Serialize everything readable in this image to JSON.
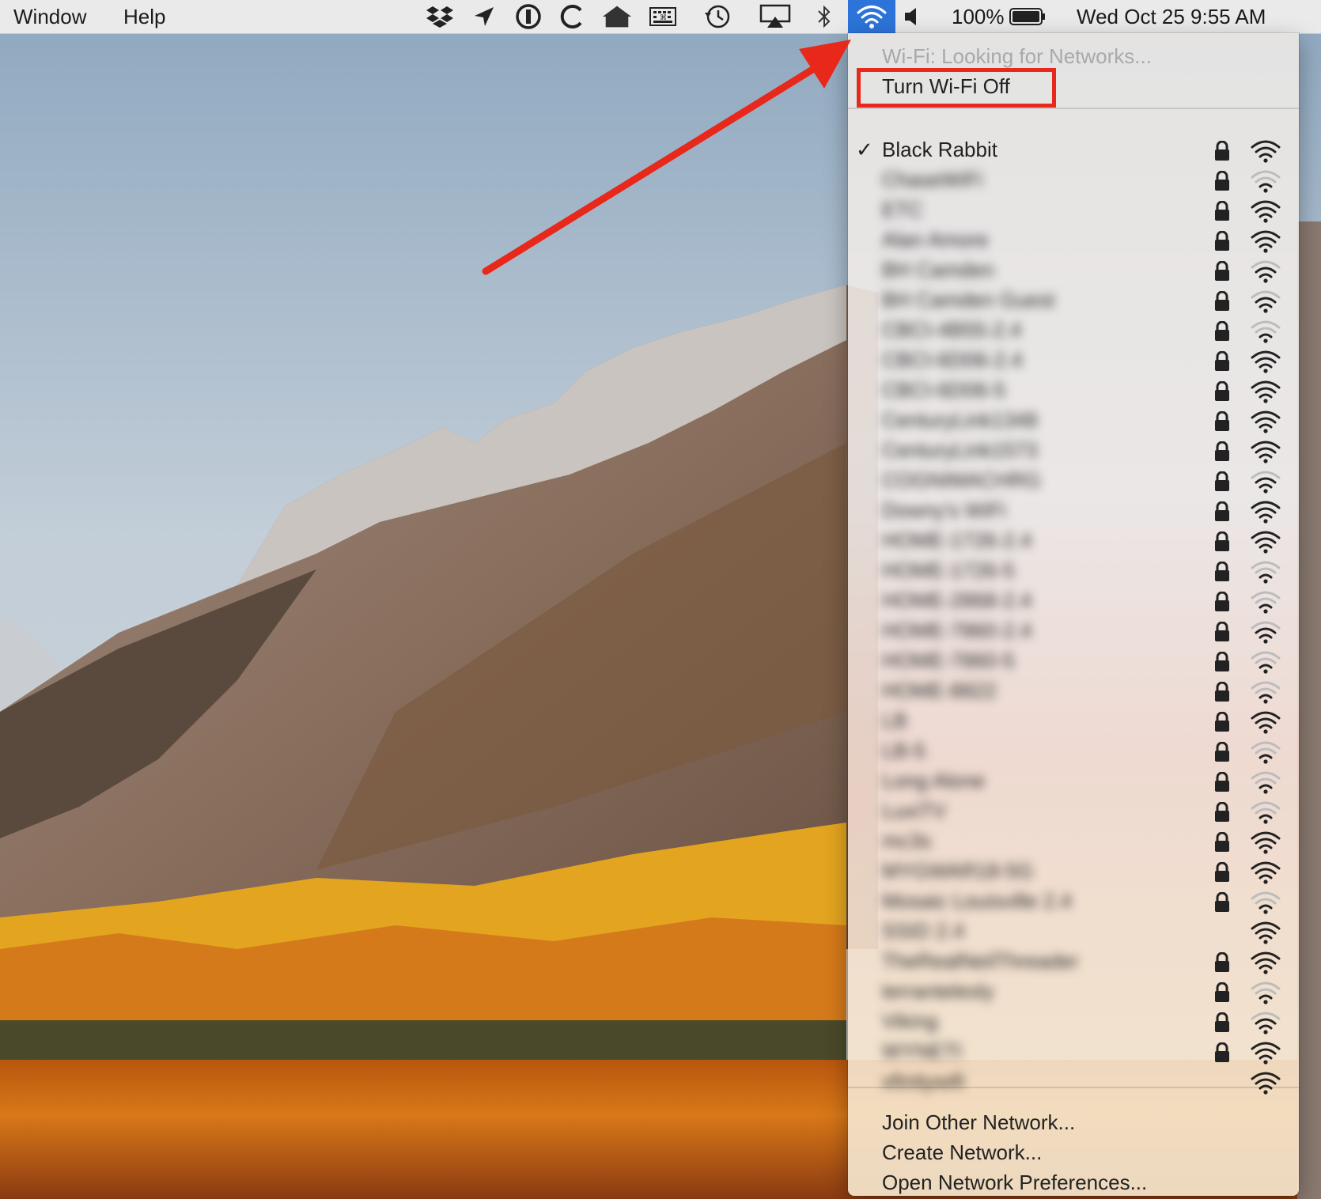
{
  "menubar": {
    "menus": [
      "Window",
      "Help"
    ],
    "status_icons": [
      "dropbox-icon",
      "location-arrow-icon",
      "1password-icon",
      "c-app-icon",
      "home-icon",
      "keyboard-viewer-icon",
      "time-machine-icon",
      "airplay-icon",
      "bluetooth-icon",
      "wifi-icon",
      "volume-icon"
    ],
    "battery_percent": "100%",
    "datetime": "Wed Oct 25  9:55 AM"
  },
  "wifi_menu": {
    "status": "Wi-Fi: Looking for Networks...",
    "toggle_label": "Turn Wi-Fi Off",
    "connected_network": "Black Rabbit",
    "networks": [
      {
        "name": "Black Rabbit",
        "secured": true,
        "signal": 3,
        "connected": true
      },
      {
        "name": "ChaseWiFi",
        "secured": true,
        "signal": 1
      },
      {
        "name": "ETC",
        "secured": true,
        "signal": 3
      },
      {
        "name": "Alan Amore",
        "secured": true,
        "signal": 3
      },
      {
        "name": "BH Camden",
        "secured": true,
        "signal": 2
      },
      {
        "name": "BH Camden Guest",
        "secured": true,
        "signal": 2
      },
      {
        "name": "CBCI-4B55-2.4",
        "secured": true,
        "signal": 1
      },
      {
        "name": "CBCI-6D06-2.4",
        "secured": true,
        "signal": 3
      },
      {
        "name": "CBCI-6D06-5",
        "secured": true,
        "signal": 3
      },
      {
        "name": "CenturyLink1348",
        "secured": true,
        "signal": 3
      },
      {
        "name": "CenturyLink1573",
        "secured": true,
        "signal": 3
      },
      {
        "name": "COGNIMACHRG",
        "secured": true,
        "signal": 2
      },
      {
        "name": "Downy's WiFi",
        "secured": true,
        "signal": 3
      },
      {
        "name": "HOME-1726-2.4",
        "secured": true,
        "signal": 3
      },
      {
        "name": "HOME-1726-5",
        "secured": true,
        "signal": 1
      },
      {
        "name": "HOME-2868-2.4",
        "secured": true,
        "signal": 1
      },
      {
        "name": "HOME-7860-2.4",
        "secured": true,
        "signal": 2
      },
      {
        "name": "HOME-7860-5",
        "secured": true,
        "signal": 1
      },
      {
        "name": "HOME-8822",
        "secured": true,
        "signal": 1
      },
      {
        "name": "LB",
        "secured": true,
        "signal": 3
      },
      {
        "name": "LB-5",
        "secured": true,
        "signal": 1
      },
      {
        "name": "Long Alone",
        "secured": true,
        "signal": 1
      },
      {
        "name": "LuxiTV",
        "secured": true,
        "signal": 1
      },
      {
        "name": "mc3s",
        "secured": true,
        "signal": 3
      },
      {
        "name": "MYGWAR18-5G",
        "secured": true,
        "signal": 3
      },
      {
        "name": "Mosaic Louisville 2.4",
        "secured": true,
        "signal": 1
      },
      {
        "name": "SSID 2.4",
        "secured": false,
        "signal": 3
      },
      {
        "name": "TheRealNeilThreader",
        "secured": true,
        "signal": 3
      },
      {
        "name": "terrantelesly",
        "secured": true,
        "signal": 1
      },
      {
        "name": "Viking",
        "secured": true,
        "signal": 2
      },
      {
        "name": "WYNETI",
        "secured": true,
        "signal": 3
      },
      {
        "name": "xfinitywifi",
        "secured": false,
        "signal": 3
      }
    ],
    "footer_items": [
      "Join Other Network...",
      "Create Network...",
      "Open Network Preferences..."
    ]
  },
  "annotation": {
    "color": "#e8281a"
  }
}
